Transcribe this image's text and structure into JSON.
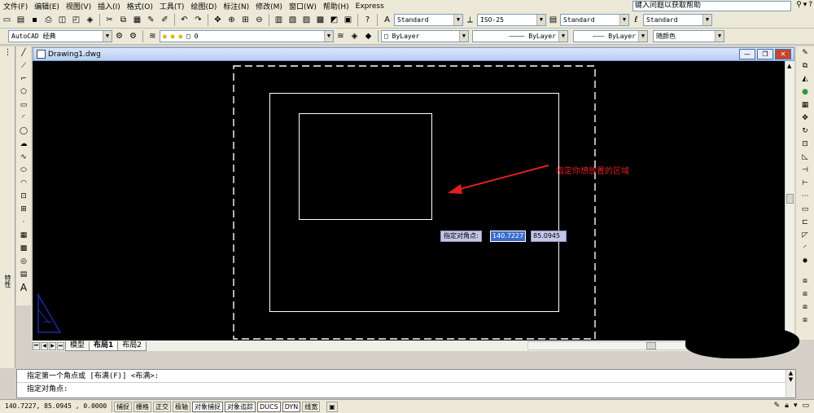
{
  "menu": [
    "文件(F)",
    "编辑(E)",
    "视图(V)",
    "插入(I)",
    "格式(O)",
    "工具(T)",
    "绘图(D)",
    "标注(N)",
    "修改(M)",
    "窗口(W)",
    "帮助(H)",
    "Express"
  ],
  "help_search": {
    "text": "键入问题以获取帮助"
  },
  "toolbar1": {
    "text_style": "Standard",
    "dim_style": "ISO-25",
    "table_style": "Standard",
    "mleader_style": "Standard"
  },
  "toolbar2": {
    "workspace": "AutoCAD 经典",
    "layer": "0",
    "color": "ByLayer",
    "linetype": "ByLayer",
    "lineweight": "ByLayer",
    "plot_style": "随颜色"
  },
  "left_palette": {
    "label": "特性"
  },
  "drawing": {
    "title": "Drawing1.dwg"
  },
  "canvas": {
    "annotation": "指定你想放置的区域",
    "prompt_label": "指定对角点:",
    "x_value": "140.7227",
    "y_value": "85.0945",
    "annotation_color": "#e02020",
    "arrow_color": "#e02020"
  },
  "layout_tabs": [
    "模型",
    "布局1",
    "布局2"
  ],
  "command": {
    "line1": "指定第一个角点或 [布满(F)] <布满>:",
    "line2": "指定对角点:"
  },
  "status": {
    "coords": "140.7227, 85.0945 , 0.0000",
    "buttons": [
      "捕捉",
      "栅格",
      "正交",
      "极轴",
      "对象捕捉",
      "对象追踪",
      "DUCS",
      "DYN",
      "线宽"
    ]
  }
}
